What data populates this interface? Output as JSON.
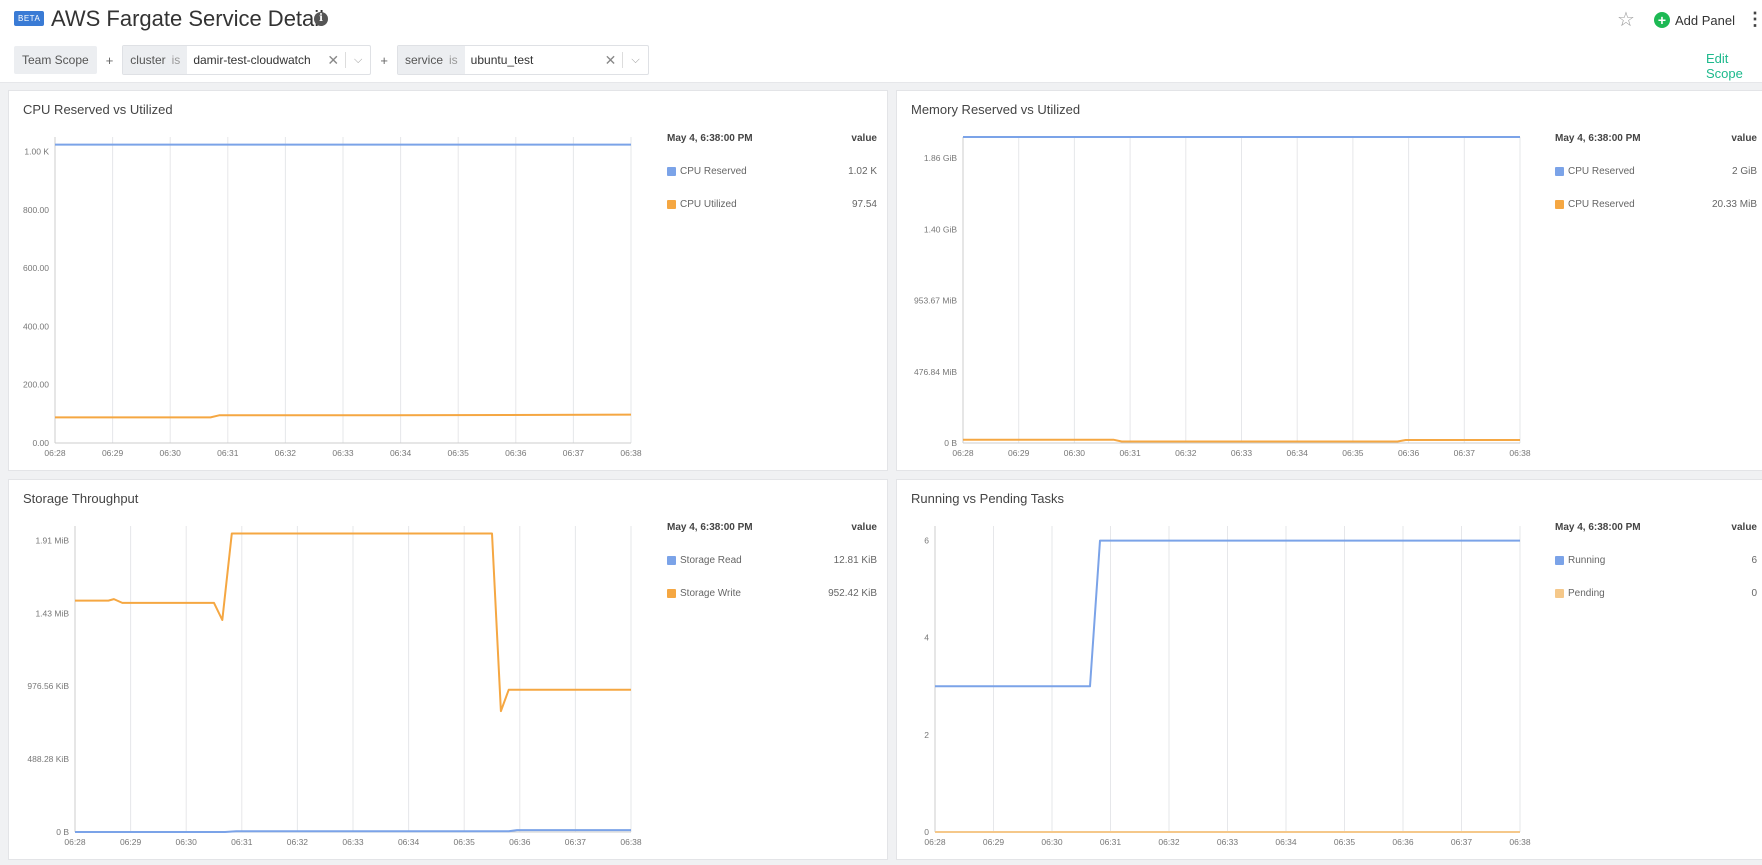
{
  "header": {
    "badge": "BETA",
    "title": "AWS Fargate Service Detail",
    "info_icon": "i",
    "star_icon": "☆",
    "add_panel_label": "Add Panel",
    "add_panel_icon": "+",
    "kebab_icon": "⋮"
  },
  "scope": {
    "team_scope_label": "Team Scope",
    "plus": "+",
    "filters": [
      {
        "key": "cluster",
        "op": "is",
        "value": "damir-test-cloudwatch"
      },
      {
        "key": "service",
        "op": "is",
        "value": "ubuntu_test"
      }
    ],
    "clear_icon": "✕",
    "chevron_icon": "⌵",
    "edit_scope_label": "Edit Scope"
  },
  "colors": {
    "blue": "#7ba3e8",
    "orange": "#f5a742",
    "accent": "#1db98c"
  },
  "chart_data": [
    {
      "id": "cpu",
      "type": "line",
      "title": "CPU Reserved vs Utilized",
      "legend_time": "May 4, 6:38:00 PM",
      "legend_value_header": "value",
      "x": [
        "06:28",
        "06:29",
        "06:30",
        "06:31",
        "06:32",
        "06:33",
        "06:34",
        "06:35",
        "06:36",
        "06:37",
        "06:38"
      ],
      "y_ticks": [
        {
          "v": 0,
          "label": "0.00"
        },
        {
          "v": 200,
          "label": "200.00"
        },
        {
          "v": 400,
          "label": "400.00"
        },
        {
          "v": 600,
          "label": "600.00"
        },
        {
          "v": 800,
          "label": "800.00"
        },
        {
          "v": 1000,
          "label": "1.00 K"
        }
      ],
      "ylim": [
        0,
        1050
      ],
      "series": [
        {
          "name": "CPU Reserved",
          "legend_value": "1.02 K",
          "color": "#7ba3e8",
          "points": [
            [
              0,
              1024
            ],
            [
              10,
              1024
            ]
          ]
        },
        {
          "name": "CPU Utilized",
          "legend_value": "97.54",
          "color": "#f5a742",
          "points": [
            [
              0,
              88
            ],
            [
              2.7,
              88
            ],
            [
              2.85,
              95
            ],
            [
              5.8,
              95
            ],
            [
              10,
              97.5
            ]
          ]
        }
      ]
    },
    {
      "id": "memory",
      "type": "line",
      "title": "Memory Reserved vs Utilized",
      "legend_time": "May 4, 6:38:00 PM",
      "legend_value_header": "value",
      "x": [
        "06:28",
        "06:29",
        "06:30",
        "06:31",
        "06:32",
        "06:33",
        "06:34",
        "06:35",
        "06:36",
        "06:37",
        "06:38"
      ],
      "y_ticks": [
        {
          "v": 0,
          "label": "0 B"
        },
        {
          "v": 476.84,
          "label": "476.84 MiB"
        },
        {
          "v": 953.67,
          "label": "953.67 MiB"
        },
        {
          "v": 1430.5,
          "label": "1.40 GiB"
        },
        {
          "v": 1907.35,
          "label": "1.86 GiB"
        }
      ],
      "ylim": [
        0,
        2048
      ],
      "series": [
        {
          "name": "CPU Reserved",
          "legend_value": "2 GiB",
          "color": "#7ba3e8",
          "points": [
            [
              0,
              2048
            ],
            [
              10,
              2048
            ]
          ]
        },
        {
          "name": "CPU Reserved",
          "legend_value": "20.33 MiB",
          "color": "#f5a742",
          "points": [
            [
              0,
              22
            ],
            [
              2.7,
              22
            ],
            [
              2.85,
              10
            ],
            [
              7.8,
              10
            ],
            [
              7.95,
              20.33
            ],
            [
              10,
              20.33
            ]
          ]
        }
      ]
    },
    {
      "id": "storage",
      "type": "line",
      "title": "Storage Throughput",
      "legend_time": "May 4, 6:38:00 PM",
      "legend_value_header": "value",
      "x": [
        "06:28",
        "06:29",
        "06:30",
        "06:31",
        "06:32",
        "06:33",
        "06:34",
        "06:35",
        "06:36",
        "06:37",
        "06:38"
      ],
      "y_ticks": [
        {
          "v": 0,
          "label": "0 B"
        },
        {
          "v": 488.28,
          "label": "488.28 KiB"
        },
        {
          "v": 976.56,
          "label": "976.56 KiB"
        },
        {
          "v": 1464.84,
          "label": "1.43 MiB"
        },
        {
          "v": 1953.13,
          "label": "1.91 MiB"
        }
      ],
      "ylim": [
        0,
        2050
      ],
      "series": [
        {
          "name": "Storage Read",
          "legend_value": "12.81 KiB",
          "color": "#7ba3e8",
          "points": [
            [
              0,
              0
            ],
            [
              2.7,
              0
            ],
            [
              2.9,
              5
            ],
            [
              7.8,
              5
            ],
            [
              7.95,
              12.81
            ],
            [
              10,
              12.81
            ]
          ]
        },
        {
          "name": "Storage Write",
          "legend_value": "952.42 KiB",
          "color": "#f5a742",
          "points": [
            [
              0,
              1550
            ],
            [
              0.6,
              1550
            ],
            [
              0.7,
              1560
            ],
            [
              0.85,
              1535
            ],
            [
              2.5,
              1535
            ],
            [
              2.65,
              1420
            ],
            [
              2.82,
              2000
            ],
            [
              7.5,
              2000
            ],
            [
              7.66,
              810
            ],
            [
              7.8,
              952.42
            ],
            [
              10,
              952.42
            ]
          ]
        }
      ]
    },
    {
      "id": "tasks",
      "type": "line",
      "title": "Running vs Pending Tasks",
      "legend_time": "May 4, 6:38:00 PM",
      "legend_value_header": "value",
      "x": [
        "06:28",
        "06:29",
        "06:30",
        "06:31",
        "06:32",
        "06:33",
        "06:34",
        "06:35",
        "06:36",
        "06:37",
        "06:38"
      ],
      "y_ticks": [
        {
          "v": 0,
          "label": "0"
        },
        {
          "v": 2,
          "label": "2"
        },
        {
          "v": 4,
          "label": "4"
        },
        {
          "v": 6,
          "label": "6"
        }
      ],
      "ylim": [
        0,
        6.3
      ],
      "series": [
        {
          "name": "Running",
          "legend_value": "6",
          "color": "#7ba3e8",
          "points": [
            [
              0,
              3
            ],
            [
              2.65,
              3
            ],
            [
              2.82,
              6
            ],
            [
              10,
              6
            ]
          ]
        },
        {
          "name": "Pending",
          "legend_value": "0",
          "color": "#f5c88a",
          "points": [
            [
              0,
              0
            ],
            [
              10,
              0
            ]
          ]
        }
      ]
    }
  ]
}
